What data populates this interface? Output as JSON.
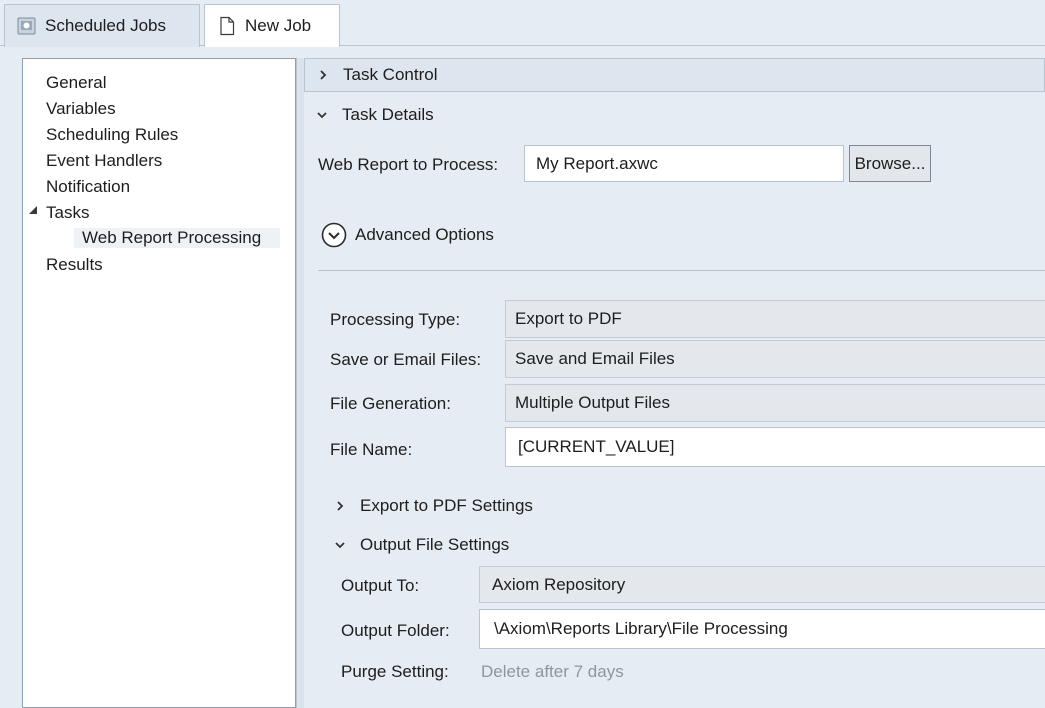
{
  "tabs": [
    {
      "label": "Scheduled Jobs",
      "icon": "scheduled-jobs-icon"
    },
    {
      "label": "New Job",
      "icon": "document-icon"
    }
  ],
  "nav": {
    "items": [
      {
        "label": "General"
      },
      {
        "label": "Variables"
      },
      {
        "label": "Scheduling Rules"
      },
      {
        "label": "Event Handlers"
      },
      {
        "label": "Notification"
      },
      {
        "label": "Tasks",
        "expanded": true
      },
      {
        "label": "Web Report Processing",
        "selected": true
      },
      {
        "label": "Results"
      }
    ]
  },
  "sections": {
    "task_control": {
      "label": "Task Control",
      "expanded": false
    },
    "task_details": {
      "label": "Task Details",
      "expanded": true
    }
  },
  "task_details": {
    "web_report_label": "Web Report to Process:",
    "web_report_value": "My Report.axwc",
    "browse_label": "Browse...",
    "advanced_label": "Advanced Options",
    "processing_type_label": "Processing Type:",
    "processing_type_value": "Export to PDF",
    "save_email_label": "Save or Email Files:",
    "save_email_value": "Save and Email Files",
    "file_generation_label": "File Generation:",
    "file_generation_value": "Multiple Output Files",
    "file_name_label": "File Name:",
    "file_name_value": "[CURRENT_VALUE]",
    "export_pdf_settings_label": "Export to PDF Settings",
    "output_file_settings_label": "Output File Settings",
    "output_to_label": "Output To:",
    "output_to_value": "Axiom Repository",
    "output_folder_label": "Output Folder:",
    "output_folder_value": "\\Axiom\\Reports Library\\File Processing",
    "purge_label": "Purge Setting:",
    "purge_value": "Delete after 7 days"
  },
  "colors": {
    "background": "#e6ecf3",
    "panel": "#ffffff",
    "header": "#dde5ee",
    "border": "#b9c4d2",
    "muted_text": "#8d96a0"
  }
}
